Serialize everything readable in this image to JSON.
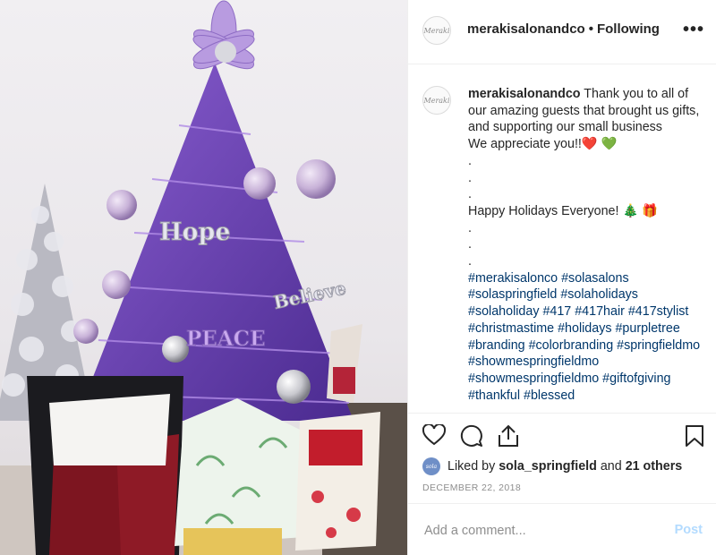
{
  "header": {
    "avatar_text": "Meraki",
    "username": "merakisalonandco",
    "separator": "•",
    "follow_status": "Following",
    "more_label": "•••"
  },
  "photo": {
    "ornament_words": [
      "Hope",
      "Believe",
      "PEACE"
    ]
  },
  "caption": {
    "username": "merakisalonandco",
    "line1": " Thank you to all of",
    "line2": "our amazing guests that brought us gifts,",
    "line3": "and supporting our small business",
    "line4": "We appreciate you!!❤️ 💚",
    "dot1": ".",
    "dot2": ".",
    "dot3": ".",
    "line_holidays": "Happy Holidays Everyone! 🎄 🎁",
    "dot4": ".",
    "dot5": ".",
    "dot6": ".",
    "hashtag_lines": [
      "#merakisalonco #solasalons",
      "#solaspringfield #solaholidays",
      "#solaholiday #417 #417hair #417stylist",
      "#christmastime #holidays #purpletree",
      "#branding #colorbranding #springfieldmo",
      "#showmespringfieldmo",
      "#showmespringfieldmo #giftofgiving",
      "#thankful #blessed"
    ]
  },
  "likes": {
    "avatar_text": "sola",
    "prefix": "Liked by ",
    "user": "sola_springfield",
    "middle": " and ",
    "others": "21 others"
  },
  "date": "DECEMBER 22, 2018",
  "comment": {
    "placeholder": "Add a comment...",
    "post_label": "Post"
  },
  "colors": {
    "link": "#00376b",
    "post_disabled": "#b3dbff",
    "tree": "#6a3fb8",
    "muted": "#8e8e8e"
  }
}
